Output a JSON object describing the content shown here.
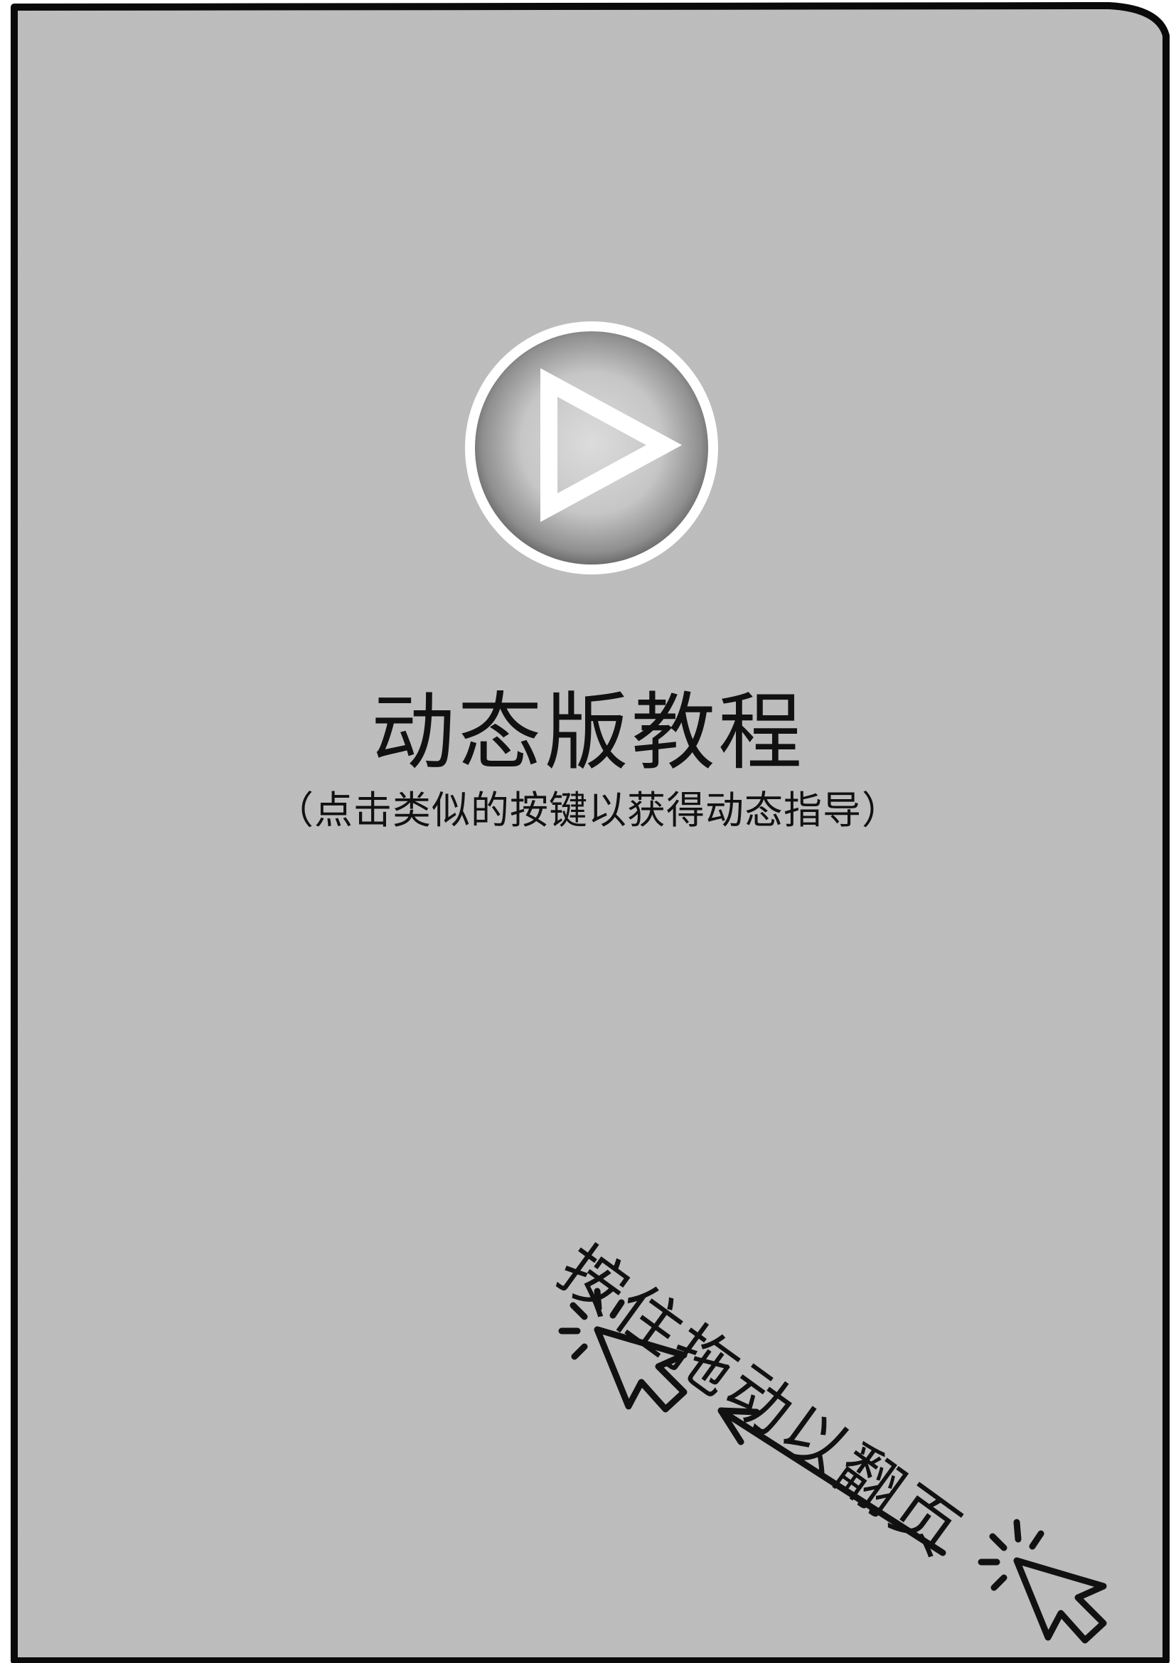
{
  "colors": {
    "paper": "#bdbdbd",
    "ink": "#111111",
    "frame": "#0a0a0a",
    "play_fill": "#c9c9c9",
    "play_ring": "#ffffff"
  },
  "page": {
    "title": "动态版教程",
    "subtitle": "（点击类似的按键以获得动态指导）"
  },
  "play_button": {
    "icon": "play-icon"
  },
  "drag_hint": {
    "label": "按住拖动以翻页",
    "icons": [
      "cursor-click-icon",
      "arrow-icon"
    ]
  }
}
